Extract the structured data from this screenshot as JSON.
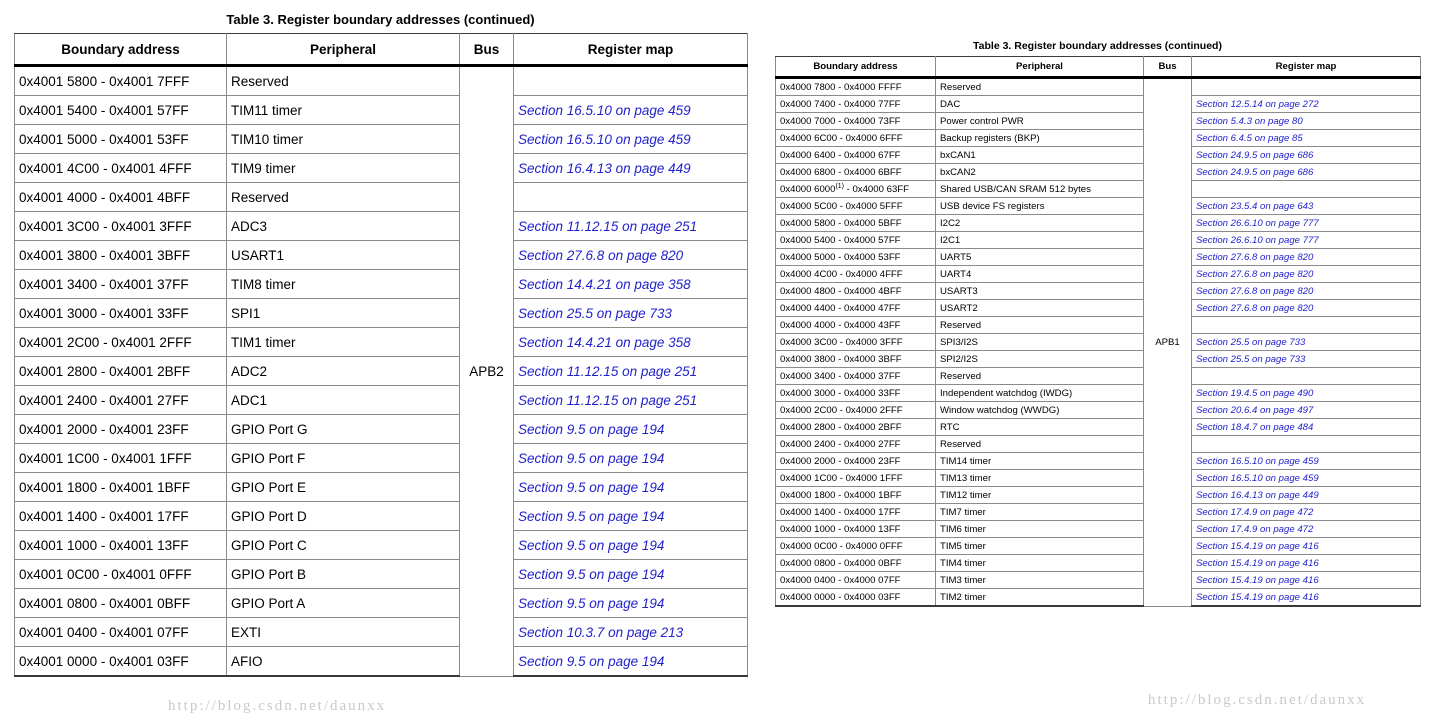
{
  "left_table": {
    "caption": "Table 3. Register boundary addresses (continued)",
    "columns": [
      "Boundary address",
      "Peripheral",
      "Bus",
      "Register map"
    ],
    "bus_label": "APB2",
    "rows": [
      {
        "address": "0x4001 5800 - 0x4001 7FFF",
        "peripheral": "Reserved",
        "register_map": ""
      },
      {
        "address": "0x4001 5400 - 0x4001 57FF",
        "peripheral": "TIM11 timer",
        "register_map": "Section 16.5.10 on page 459"
      },
      {
        "address": "0x4001 5000 - 0x4001 53FF",
        "peripheral": "TIM10 timer",
        "register_map": "Section 16.5.10 on page 459"
      },
      {
        "address": "0x4001 4C00 - 0x4001 4FFF",
        "peripheral": "TIM9 timer",
        "register_map": "Section 16.4.13 on page 449"
      },
      {
        "address": "0x4001 4000 - 0x4001 4BFF",
        "peripheral": "Reserved",
        "register_map": ""
      },
      {
        "address": "0x4001 3C00 - 0x4001 3FFF",
        "peripheral": "ADC3",
        "register_map": "Section 11.12.15 on page 251"
      },
      {
        "address": "0x4001 3800 - 0x4001 3BFF",
        "peripheral": "USART1",
        "register_map": "Section 27.6.8 on page 820"
      },
      {
        "address": "0x4001 3400 - 0x4001 37FF",
        "peripheral": "TIM8 timer",
        "register_map": "Section 14.4.21 on page 358"
      },
      {
        "address": "0x4001 3000 - 0x4001 33FF",
        "peripheral": "SPI1",
        "register_map": "Section 25.5 on page 733"
      },
      {
        "address": "0x4001 2C00 - 0x4001 2FFF",
        "peripheral": "TIM1 timer",
        "register_map": "Section 14.4.21 on page 358"
      },
      {
        "address": "0x4001 2800 - 0x4001 2BFF",
        "peripheral": "ADC2",
        "register_map": "Section 11.12.15 on page 251"
      },
      {
        "address": "0x4001 2400 - 0x4001 27FF",
        "peripheral": "ADC1",
        "register_map": "Section 11.12.15 on page 251"
      },
      {
        "address": "0x4001 2000 - 0x4001 23FF",
        "peripheral": "GPIO Port G",
        "register_map": "Section 9.5 on page 194"
      },
      {
        "address": "0x4001 1C00 - 0x4001 1FFF",
        "peripheral": "GPIO Port F",
        "register_map": "Section 9.5 on page 194"
      },
      {
        "address": "0x4001 1800 - 0x4001 1BFF",
        "peripheral": "GPIO Port E",
        "register_map": "Section 9.5 on page 194"
      },
      {
        "address": "0x4001 1400 - 0x4001 17FF",
        "peripheral": "GPIO Port D",
        "register_map": "Section 9.5 on page 194"
      },
      {
        "address": "0x4001 1000 - 0x4001 13FF",
        "peripheral": "GPIO Port C",
        "register_map": "Section 9.5 on page 194"
      },
      {
        "address": "0x4001 0C00 - 0x4001 0FFF",
        "peripheral": "GPIO Port B",
        "register_map": "Section 9.5 on page 194"
      },
      {
        "address": "0x4001 0800 - 0x4001 0BFF",
        "peripheral": "GPIO Port A",
        "register_map": "Section 9.5 on page 194"
      },
      {
        "address": "0x4001 0400 - 0x4001 07FF",
        "peripheral": "EXTI",
        "register_map": "Section 10.3.7 on page 213"
      },
      {
        "address": "0x4001 0000 - 0x4001 03FF",
        "peripheral": "AFIO",
        "register_map": "Section 9.5 on page 194"
      }
    ]
  },
  "right_table": {
    "caption": "Table 3. Register boundary addresses (continued)",
    "columns": [
      "Boundary address",
      "Peripheral",
      "Bus",
      "Register map"
    ],
    "bus_label": "APB1",
    "rows": [
      {
        "address": "0x4000 7800 - 0x4000 FFFF",
        "peripheral": "Reserved",
        "register_map": ""
      },
      {
        "address": "0x4000 7400 - 0x4000 77FF",
        "peripheral": "DAC",
        "register_map": "Section 12.5.14 on page 272"
      },
      {
        "address": "0x4000 7000 - 0x4000 73FF",
        "peripheral": "Power control PWR",
        "register_map": "Section 5.4.3 on page 80"
      },
      {
        "address": "0x4000 6C00 - 0x4000 6FFF",
        "peripheral": "Backup registers (BKP)",
        "register_map": "Section 6.4.5 on page 85"
      },
      {
        "address": "0x4000 6400 - 0x4000 67FF",
        "peripheral": "bxCAN1",
        "register_map": "Section 24.9.5 on page 686"
      },
      {
        "address": "0x4000 6800 - 0x4000 6BFF",
        "peripheral": "bxCAN2",
        "register_map": "Section 24.9.5 on page 686"
      },
      {
        "address": "0x4000 6000(1) - 0x4000 63FF",
        "address_sup": "1",
        "address_pre": "0x4000 6000",
        "address_post": " - 0x4000 63FF",
        "peripheral": "Shared USB/CAN SRAM 512 bytes",
        "register_map": ""
      },
      {
        "address": "0x4000 5C00 - 0x4000 5FFF",
        "peripheral": "USB device FS registers",
        "register_map": "Section 23.5.4 on page 643"
      },
      {
        "address": "0x4000 5800 - 0x4000 5BFF",
        "peripheral": "I2C2",
        "register_map": "Section 26.6.10 on page 777"
      },
      {
        "address": "0x4000 5400 - 0x4000 57FF",
        "peripheral": "I2C1",
        "register_map": "Section 26.6.10 on page 777"
      },
      {
        "address": "0x4000 5000 - 0x4000 53FF",
        "peripheral": "UART5",
        "register_map": "Section 27.6.8 on page 820"
      },
      {
        "address": "0x4000 4C00 - 0x4000 4FFF",
        "peripheral": "UART4",
        "register_map": "Section 27.6.8 on page 820"
      },
      {
        "address": "0x4000 4800 - 0x4000 4BFF",
        "peripheral": "USART3",
        "register_map": "Section 27.6.8 on page 820"
      },
      {
        "address": "0x4000 4400 - 0x4000 47FF",
        "peripheral": "USART2",
        "register_map": "Section 27.6.8 on page 820"
      },
      {
        "address": "0x4000 4000 - 0x4000 43FF",
        "peripheral": "Reserved",
        "register_map": ""
      },
      {
        "address": "0x4000 3C00 - 0x4000 3FFF",
        "peripheral": "SPI3/I2S",
        "register_map": "Section 25.5 on page 733"
      },
      {
        "address": "0x4000 3800 - 0x4000 3BFF",
        "peripheral": "SPI2/I2S",
        "register_map": "Section 25.5 on page 733"
      },
      {
        "address": "0x4000 3400 - 0x4000 37FF",
        "peripheral": "Reserved",
        "register_map": ""
      },
      {
        "address": "0x4000 3000 - 0x4000 33FF",
        "peripheral": "Independent watchdog (IWDG)",
        "register_map": "Section 19.4.5 on page 490"
      },
      {
        "address": "0x4000 2C00 - 0x4000 2FFF",
        "peripheral": "Window watchdog (WWDG)",
        "register_map": "Section 20.6.4 on page 497"
      },
      {
        "address": "0x4000 2800 - 0x4000 2BFF",
        "peripheral": "RTC",
        "register_map": "Section 18.4.7 on page 484"
      },
      {
        "address": "0x4000 2400 - 0x4000 27FF",
        "peripheral": "Reserved",
        "register_map": ""
      },
      {
        "address": "0x4000 2000 - 0x4000 23FF",
        "peripheral": "TIM14 timer",
        "register_map": "Section 16.5.10 on page 459"
      },
      {
        "address": "0x4000 1C00 - 0x4000 1FFF",
        "peripheral": "TIM13 timer",
        "register_map": "Section 16.5.10 on page 459"
      },
      {
        "address": "0x4000 1800 - 0x4000 1BFF",
        "peripheral": "TIM12 timer",
        "register_map": "Section 16.4.13 on page 449"
      },
      {
        "address": "0x4000 1400 - 0x4000 17FF",
        "peripheral": "TIM7 timer",
        "register_map": "Section 17.4.9 on page 472"
      },
      {
        "address": "0x4000 1000 - 0x4000 13FF",
        "peripheral": "TIM6 timer",
        "register_map": "Section 17.4.9 on page 472"
      },
      {
        "address": "0x4000 0C00 - 0x4000 0FFF",
        "peripheral": "TIM5 timer",
        "register_map": "Section 15.4.19 on page 416"
      },
      {
        "address": "0x4000 0800 - 0x4000 0BFF",
        "peripheral": "TIM4 timer",
        "register_map": "Section 15.4.19 on page 416"
      },
      {
        "address": "0x4000 0400 - 0x4000 07FF",
        "peripheral": "TIM3 timer",
        "register_map": "Section 15.4.19 on page 416"
      },
      {
        "address": "0x4000 0000 - 0x4000 03FF",
        "peripheral": "TIM2 timer",
        "register_map": "Section 15.4.19 on page 416"
      }
    ]
  },
  "watermarks": {
    "left": "http://blog.csdn.net/daunxx",
    "right": "http://blog.csdn.net/daunxx"
  }
}
